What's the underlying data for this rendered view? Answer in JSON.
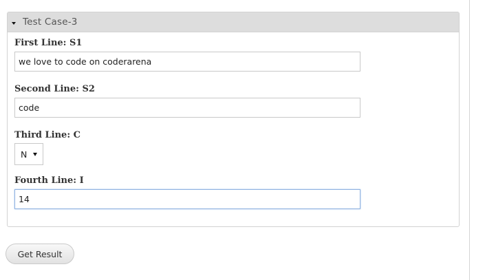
{
  "test_case": {
    "title": "Test Case-3",
    "fields": [
      {
        "label": "First Line: S1",
        "value": "we love to code on coderarena"
      },
      {
        "label": "Second Line: S2",
        "value": "code"
      },
      {
        "label": "Third Line: C",
        "selected": "N"
      },
      {
        "label": "Fourth Line: I",
        "value": "14"
      }
    ]
  },
  "actions": {
    "get_result_label": "Get Result"
  }
}
